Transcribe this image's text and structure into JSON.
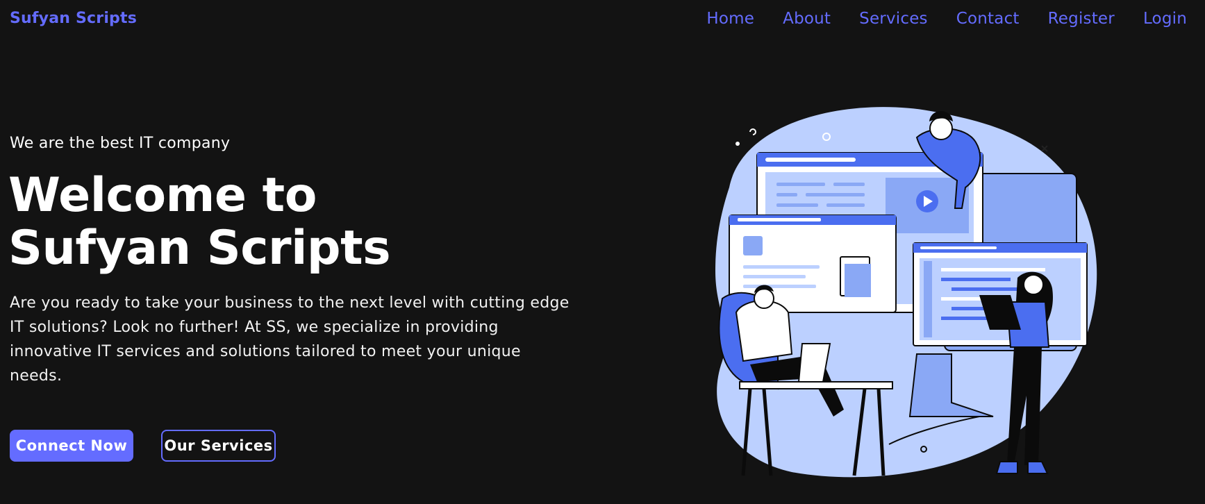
{
  "header": {
    "brand": "Sufyan Scripts",
    "nav": [
      {
        "label": "Home"
      },
      {
        "label": "About"
      },
      {
        "label": "Services"
      },
      {
        "label": "Contact"
      },
      {
        "label": "Register"
      },
      {
        "label": "Login"
      }
    ]
  },
  "hero": {
    "tagline": "We are the best IT company",
    "title": "Welcome to Sufyan Scripts",
    "description": "Are you ready to take your business to the next level with cutting edge IT solutions? Look no further! At SS, we specialize in providing innovative IT services and solutions tailored to meet your unique needs.",
    "primary_button": "Connect Now",
    "secondary_button": "Our Services"
  },
  "colors": {
    "background": "#131313",
    "accent": "#646cff",
    "illustration_light": "#bcd0ff",
    "illustration_mid": "#8aa8f5",
    "illustration_dark": "#4b6ef0"
  },
  "icons": {
    "hero_illustration": "team-working-on-web-design-illustration",
    "play": "play-icon"
  }
}
